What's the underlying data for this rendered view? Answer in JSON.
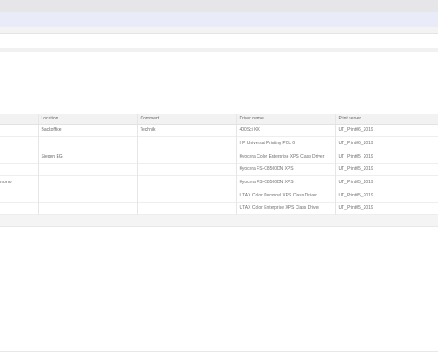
{
  "table": {
    "columns": [
      "",
      "Location",
      "Comment",
      "Driver name",
      "Print server"
    ],
    "rows": [
      [
        "",
        "Backoffice",
        "Technik",
        "400Sci KX",
        "UT_Print06_2019"
      ],
      [
        "",
        "",
        "",
        "HP Universal Printing PCL 6",
        "UT_Print06_2019"
      ],
      [
        "",
        "Siegen EG",
        "",
        "Kyocera Color Enterprise XPS Class Driver",
        "UT_Print05_2019"
      ],
      [
        "",
        "",
        "",
        "Kyocera FS-C8500DN XPS",
        "UT_Print05_2019"
      ],
      [
        "mono",
        "",
        "",
        "Kyocera FS-C8500DN XPS",
        "UT_Print05_2019"
      ],
      [
        "",
        "",
        "",
        "UTAX Color Personal XPS Class Driver",
        "UT_Print05_2019"
      ],
      [
        "",
        "",
        "",
        "UTAX Color Enterprise XPS Class Driver",
        "UT_Print05_2019"
      ]
    ]
  }
}
